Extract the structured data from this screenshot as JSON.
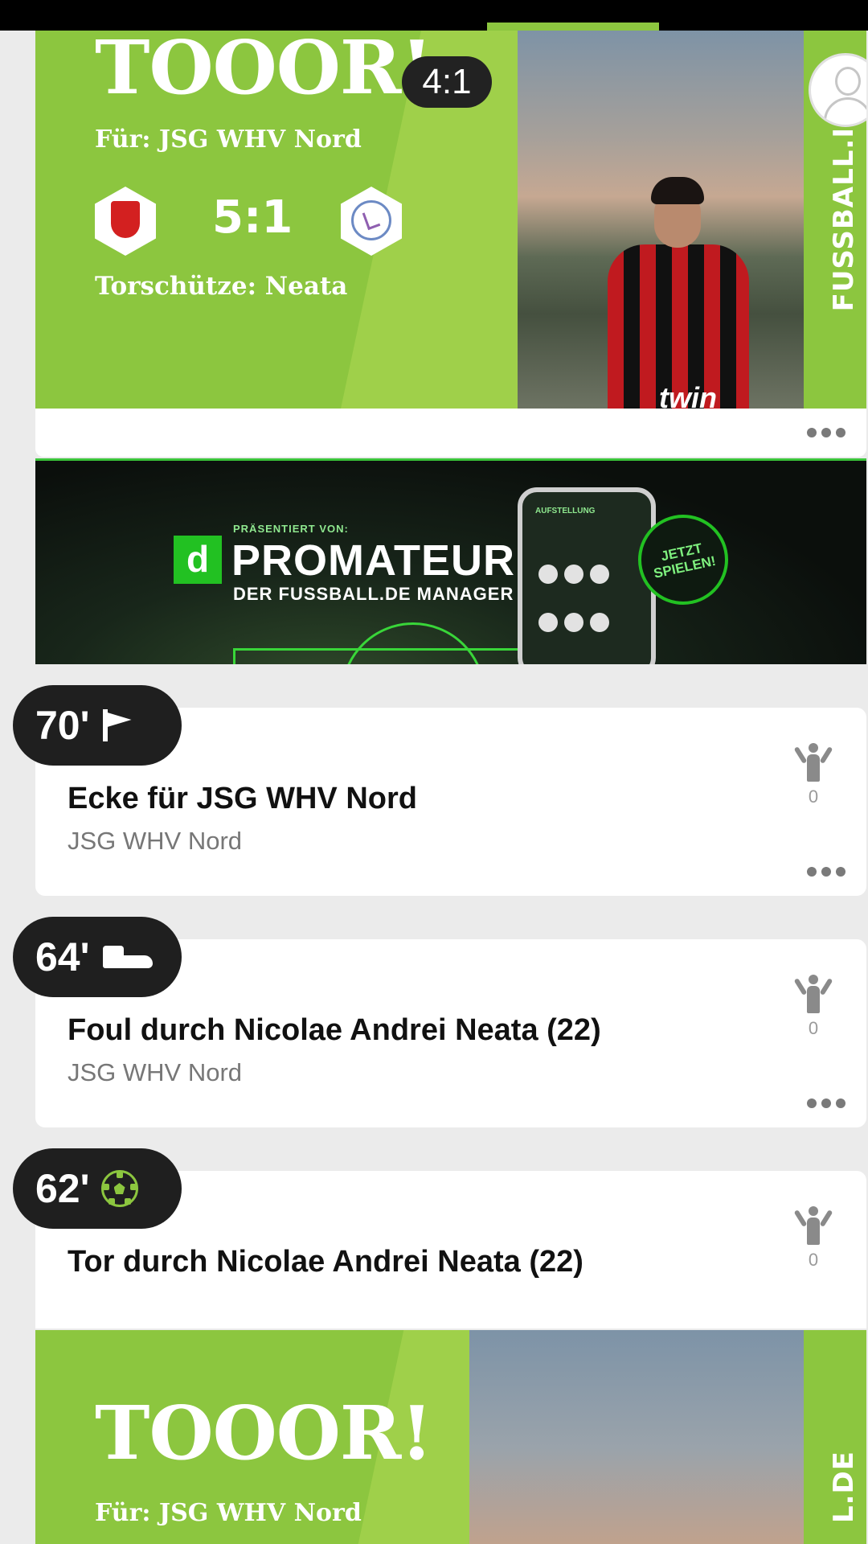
{
  "colors": {
    "accent_green": "#8cc63f",
    "pill_dark": "#1f1f1f",
    "page_bg": "#ebebeb"
  },
  "goal_post_1": {
    "title": "TOOOR!",
    "for_team": "Für: JSG WHV Nord",
    "score": "5:1",
    "scorer": "Torschütze: Neata",
    "edge_text": "FUSSBALL.I",
    "overlay_score": "4:1",
    "player_shirt_text": "twin"
  },
  "ad": {
    "presented_by": "PRÄSENTIERT VON:",
    "logo_letter": "d",
    "brand": "PROMATEUR",
    "subtitle": "DER FUSSBALL.DE MANAGER",
    "phone_title": "AUFSTELLUNG",
    "badge": "JETZT SPIELEN!"
  },
  "events": [
    {
      "minute": "70'",
      "icon": "corner-flag-icon",
      "title": "Ecke für JSG WHV Nord",
      "team": "JSG WHV Nord",
      "likes": "0"
    },
    {
      "minute": "64'",
      "icon": "boot-icon",
      "title": "Foul durch Nicolae Andrei Neata (22)",
      "team": "JSG WHV Nord",
      "likes": "0"
    },
    {
      "minute": "62'",
      "icon": "ball-icon",
      "title": "Tor durch Nicolae Andrei Neata (22)",
      "likes": "0"
    }
  ],
  "goal_post_2": {
    "title": "TOOOR!",
    "for_team": "Für: JSG WHV Nord",
    "edge_text": "L.DE"
  }
}
